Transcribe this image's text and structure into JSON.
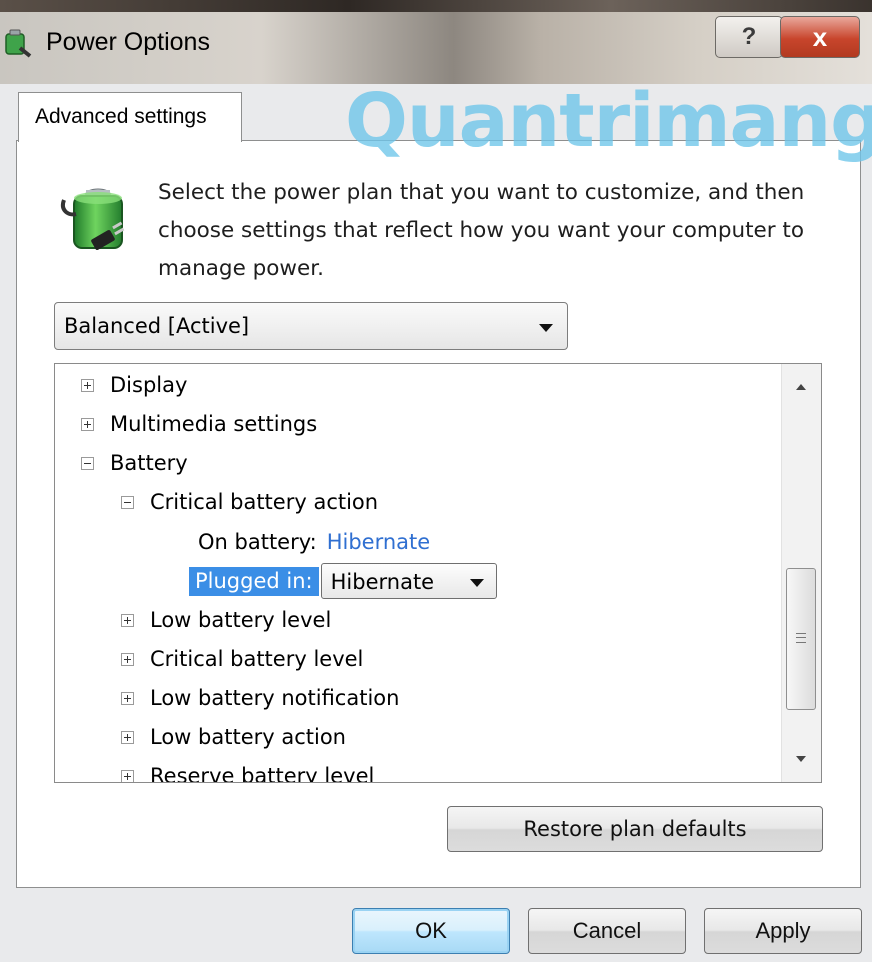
{
  "window": {
    "title": "Power Options",
    "help_label": "?",
    "close_label": "x"
  },
  "watermark": "Quantrimang",
  "tab": {
    "label": "Advanced settings"
  },
  "intro_text": "Select the power plan that you want to customize, and then choose settings that reflect how you want your computer to manage power.",
  "plan_select": {
    "value": "Balanced [Active]"
  },
  "tree": {
    "display": "Display",
    "multimedia": "Multimedia settings",
    "battery": "Battery",
    "critical_action": "Critical battery action",
    "on_battery_label": "On battery:",
    "on_battery_value": "Hibernate",
    "plugged_in_label": "Plugged in:",
    "plugged_in_value": "Hibernate",
    "low_level": "Low battery level",
    "critical_level": "Critical battery level",
    "low_notification": "Low battery notification",
    "low_action": "Low battery action",
    "reserve_level": "Reserve battery level"
  },
  "buttons": {
    "restore": "Restore plan defaults",
    "ok": "OK",
    "cancel": "Cancel",
    "apply": "Apply"
  },
  "colors": {
    "selection": "#3b8ee6",
    "link": "#2f6fd1",
    "close_button": "#c8452c",
    "watermark": "#6ec6ea"
  }
}
